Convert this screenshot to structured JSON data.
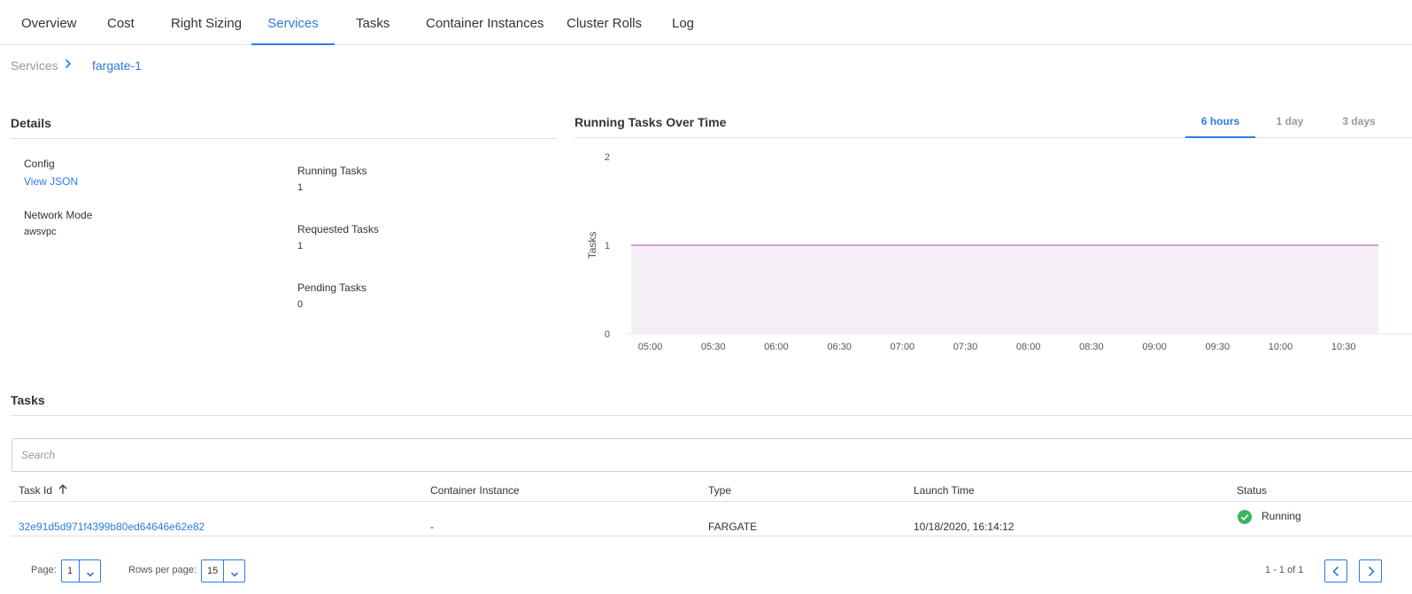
{
  "tabs": [
    {
      "label": "Overview"
    },
    {
      "label": "Cost"
    },
    {
      "label": "Right Sizing"
    },
    {
      "label": "Services"
    },
    {
      "label": "Tasks"
    },
    {
      "label": "Container Instances"
    },
    {
      "label": "Cluster Rolls"
    },
    {
      "label": "Log"
    }
  ],
  "breadcrumb": {
    "root": "Services",
    "current": "fargate-1"
  },
  "details": {
    "title": "Details",
    "config_label": "Config",
    "config_link": "View JSON",
    "network_mode_label": "Network Mode",
    "network_mode_value": "awsvpc",
    "running_tasks_label": "Running Tasks",
    "running_tasks_value": "1",
    "requested_tasks_label": "Requested Tasks",
    "requested_tasks_value": "1",
    "pending_tasks_label": "Pending Tasks",
    "pending_tasks_value": "0"
  },
  "chart_panel": {
    "title": "Running Tasks Over Time",
    "ranges": [
      "6 hours",
      "1 day",
      "3 days"
    ],
    "selected_range": "6 hours"
  },
  "chart_data": {
    "type": "area",
    "title": "Running Tasks Over Time",
    "xlabel": "",
    "ylabel": "Tasks",
    "x_ticks": [
      "05:00",
      "05:30",
      "06:00",
      "06:30",
      "07:00",
      "07:30",
      "08:00",
      "08:30",
      "09:00",
      "09:30",
      "10:00",
      "10:30"
    ],
    "y_ticks": [
      "0",
      "1",
      "2"
    ],
    "ylim": [
      0,
      2
    ],
    "series": [
      {
        "values": [
          1,
          1,
          1,
          1,
          1,
          1,
          1,
          1,
          1,
          1,
          1,
          1,
          1
        ]
      }
    ],
    "color": "#c586c5",
    "fill": "#f5eef7",
    "grid": false
  },
  "tasks": {
    "title": "Tasks",
    "search_placeholder": "Search",
    "columns": [
      "Task Id",
      "Container Instance",
      "Type",
      "Launch Time",
      "Status"
    ],
    "rows": [
      {
        "task_id": "32e91d5d971f4399b80ed64646e62e82",
        "container_instance": "-",
        "type": "FARGATE",
        "launch_time": "10/18/2020, 16:14:12",
        "status": "Running"
      }
    ],
    "status_color": "#3cb55e"
  },
  "pager": {
    "page_label": "Page:",
    "page_value": "1",
    "rows_label": "Rows per page:",
    "rows_value": "15",
    "count": "1 - 1 of 1"
  },
  "accent": "#2d7be5"
}
